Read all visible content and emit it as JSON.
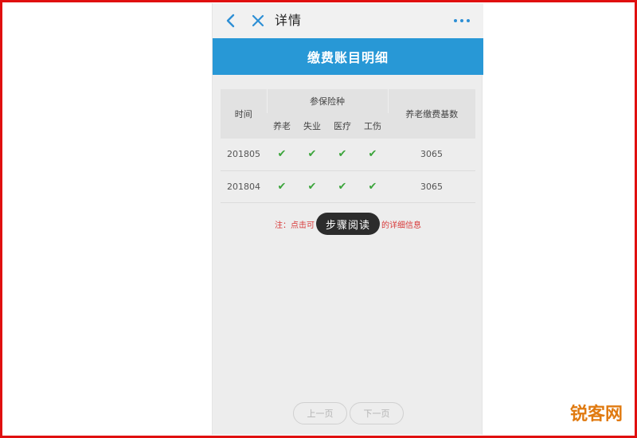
{
  "nav": {
    "title": "详情",
    "back_icon": "chevron-left-icon",
    "close_icon": "close-icon",
    "more_icon": "more-horizontal-icon"
  },
  "banner": {
    "title": "缴费账目明细"
  },
  "table": {
    "group_header": "参保险种",
    "time_header": "时间",
    "insurance_types": [
      "养老",
      "失业",
      "医疗",
      "工伤"
    ],
    "base_header": "养老缴费基数",
    "rows": [
      {
        "period": "201805",
        "checks": [
          "✔",
          "✔",
          "✔",
          "✔"
        ],
        "base": "3065"
      },
      {
        "period": "201804",
        "checks": [
          "✔",
          "✔",
          "✔",
          "✔"
        ],
        "base": "3065"
      }
    ]
  },
  "note": {
    "prefix": "注：点击可",
    "suffix": "的详细信息"
  },
  "toast": {
    "text": "步骤阅读"
  },
  "pager": {
    "prev_label": "上一页",
    "next_label": "下一页"
  },
  "watermark": {
    "text": "锐客网"
  },
  "colors": {
    "accent": "#2898d6",
    "check": "#3aa43a",
    "note": "#d83a3a",
    "frame": "#e01010",
    "watermark": "#e07a10"
  }
}
